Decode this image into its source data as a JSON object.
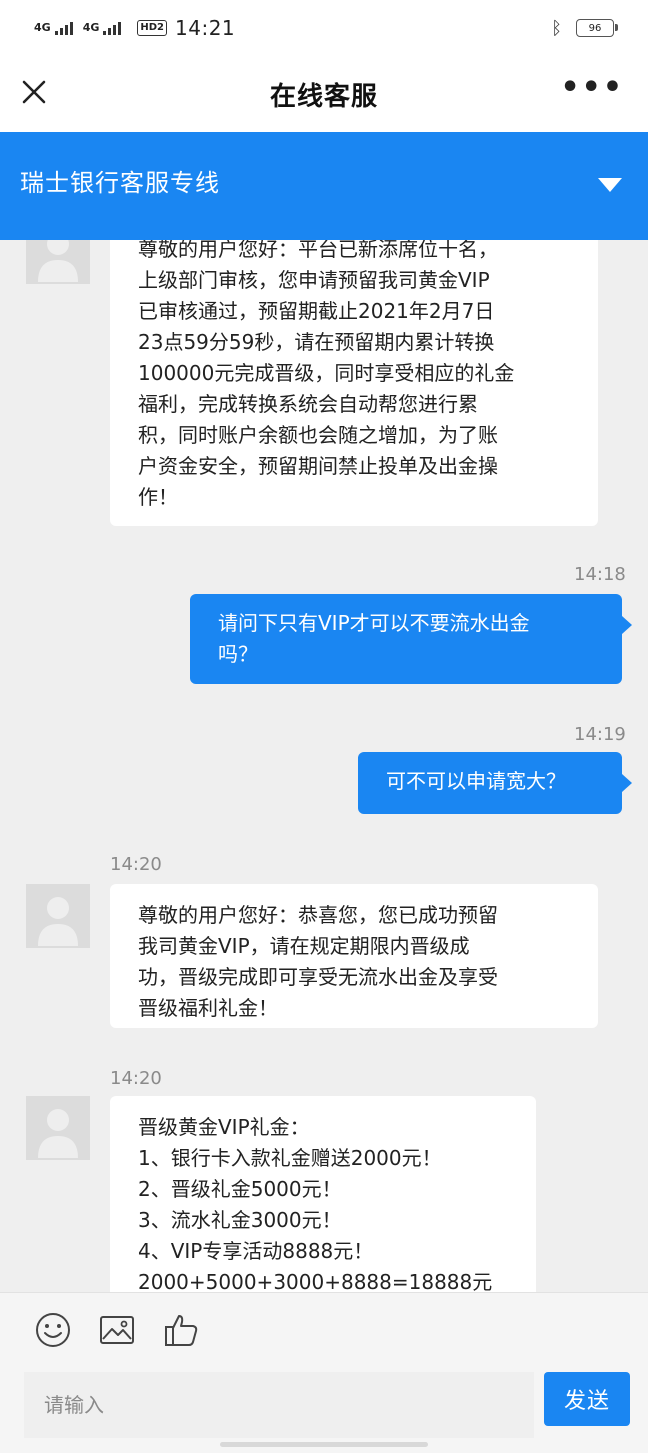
{
  "status_bar": {
    "network_1": "4G",
    "network_2": "4G",
    "hd_badge": "HD2",
    "time": "14:21",
    "bluetooth_icon": "bluetooth-icon",
    "battery": "96"
  },
  "nav": {
    "close_icon": "close-icon",
    "title": "在线客服",
    "more_icon": "more-dots-icon",
    "more_glyph": "•••"
  },
  "service_header": {
    "title": "瑞士银行客服专线",
    "dropdown_icon": "triangle-down-icon",
    "color": "#1a86f2"
  },
  "messages": [
    {
      "sender": "agent",
      "timestamp": "",
      "lines": [
        "尊敬的用户您好：平台已新添席位十名，",
        "上级部门审核，您申请预留我司黄金VIP",
        "已审核通过，预留期截止2021年2月7日",
        "23点59分59秒，请在预留期内累计转换",
        "100000元完成晋级，同时享受相应的礼金",
        "福利，完成转换系统会自动帮您进行累",
        "积，同时账户余额也会随之增加，为了账",
        "户资金安全，预留期间禁止投单及出金操",
        "作！"
      ]
    },
    {
      "sender": "user",
      "timestamp": "14:18",
      "lines": [
        "请问下只有VIP才可以不要流水出金",
        "吗？"
      ]
    },
    {
      "sender": "user",
      "timestamp": "14:19",
      "lines": [
        "可不可以申请宽大？"
      ]
    },
    {
      "sender": "agent",
      "timestamp": "14:20",
      "lines": [
        "尊敬的用户您好：恭喜您，您已成功预留",
        "我司黄金VIP，请在规定期限内晋级成",
        "功，晋级完成即可享受无流水出金及享受",
        "晋级福利礼金！"
      ]
    },
    {
      "sender": "agent",
      "timestamp": "14:20",
      "lines": [
        "晋级黄金VIP礼金：",
        "1、银行卡入款礼金赠送2000元！",
        "2、晋级礼金5000元！",
        "3、流水礼金3000元！",
        "4、VIP专享活动8888元！",
        "2000+5000+3000+8888=18888元"
      ]
    }
  ],
  "toolbar": {
    "icons": [
      "emoji-icon",
      "image-icon",
      "thumbs-up-icon"
    ]
  },
  "composer": {
    "placeholder": "请输入",
    "send_label": "发送"
  },
  "colors": {
    "accent": "#1a86f2",
    "background": "#efefef"
  }
}
